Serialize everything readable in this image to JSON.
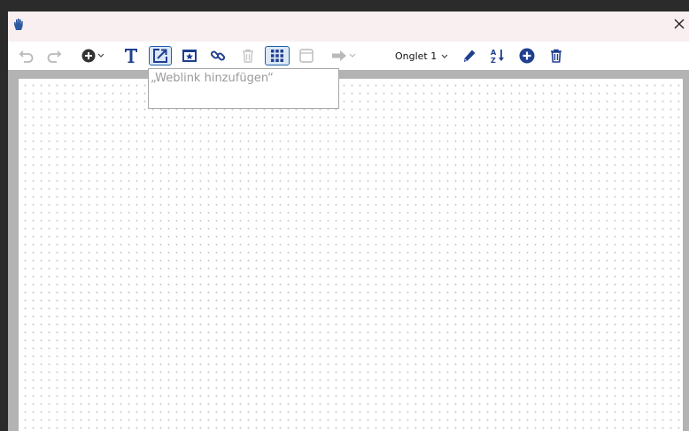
{
  "toolbar": {
    "tab_selector": {
      "label": "Onglet 1"
    }
  },
  "tooltip": {
    "text": "„Weblink hinzufügen“"
  },
  "colors": {
    "accent": "#1f3f8f",
    "titlebar": "#f9eff0",
    "canvas_border": "#b3b3b3",
    "disabled": "#b9b9b9"
  },
  "icons": [
    "hand-icon",
    "close-icon",
    "undo-icon",
    "redo-icon",
    "add-circle-icon",
    "text-icon",
    "weblink-icon",
    "star-card-icon",
    "link-icon",
    "trash-disabled-icon",
    "grid-icon",
    "frame-icon",
    "arrow-right-icon",
    "pencil-icon",
    "sort-az-icon",
    "add-tab-icon",
    "delete-tab-icon"
  ]
}
